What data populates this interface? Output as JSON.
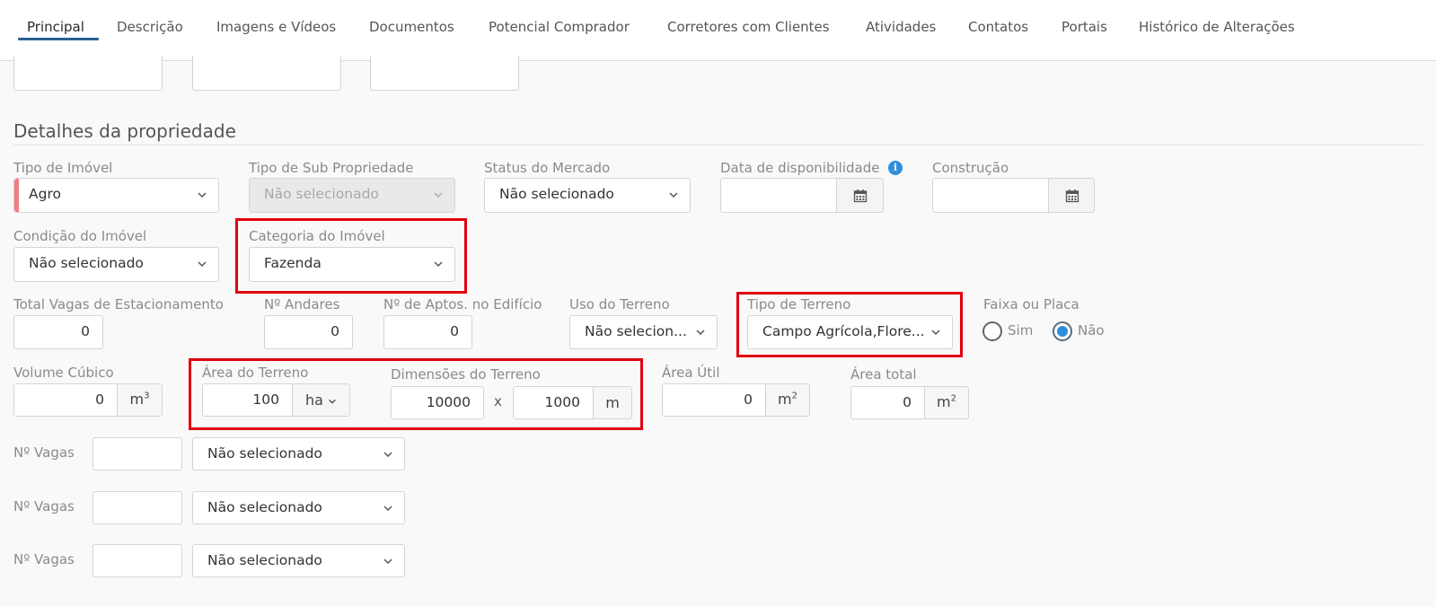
{
  "tabs": [
    "Principal",
    "Descrição",
    "Imagens e Vídeos",
    "Documentos",
    "Potencial Comprador",
    "Corretores com Clientes",
    "Atividades",
    "Contatos",
    "Portais",
    "Histórico de Alterações"
  ],
  "section_title": "Detalhes da propriedade",
  "fields": {
    "tipo_imovel": {
      "label": "Tipo de Imóvel",
      "value": "Agro"
    },
    "tipo_sub": {
      "label": "Tipo de Sub Propriedade",
      "value": "Não selecionado"
    },
    "status_mercado": {
      "label": "Status do Mercado",
      "value": "Não selecionado"
    },
    "data_disp": {
      "label": "Data de disponibilidade",
      "value": ""
    },
    "construcao": {
      "label": "Construção",
      "value": ""
    },
    "condicao": {
      "label": "Condição do Imóvel",
      "value": "Não selecionado"
    },
    "categoria": {
      "label": "Categoria do Imóvel",
      "value": "Fazenda"
    },
    "vagas_total": {
      "label": "Total Vagas de Estacionamento",
      "value": "0"
    },
    "andares": {
      "label": "Nº Andares",
      "value": "0"
    },
    "aptos": {
      "label": "Nº de Aptos. no Edifício",
      "value": "0"
    },
    "uso_terreno": {
      "label": "Uso do Terreno",
      "value": "Não selecion..."
    },
    "tipo_terreno": {
      "label": "Tipo de Terreno",
      "value": "Campo Agrícola,Flore..."
    },
    "faixa": {
      "label": "Faixa ou Placa",
      "opt_sim": "Sim",
      "opt_nao": "Não"
    },
    "volume": {
      "label": "Volume Cúbico",
      "value": "0",
      "unit": "m",
      "unit_sup": "3"
    },
    "area_terreno": {
      "label": "Área do Terreno",
      "value": "100",
      "unit": "ha"
    },
    "dimensoes": {
      "label": "Dimensões do Terreno",
      "value_a": "10000",
      "sep": "x",
      "value_b": "1000",
      "unit": "m"
    },
    "area_util": {
      "label": "Área Útil",
      "value": "0",
      "unit": "m",
      "unit_sup": "2"
    },
    "area_total": {
      "label": "Área total",
      "value": "0",
      "unit": "m",
      "unit_sup": "2"
    },
    "vagas_rows": [
      {
        "label": "Nº Vagas",
        "value": "",
        "select": "Não selecionado"
      },
      {
        "label": "Nº Vagas",
        "value": "",
        "select": "Não selecionado"
      },
      {
        "label": "Nº Vagas",
        "value": "",
        "select": "Não selecionado"
      }
    ]
  },
  "colors": {
    "highlight": "#e0000f",
    "accent": "#2f8fdd",
    "tab_underline": "#2c5f91"
  }
}
